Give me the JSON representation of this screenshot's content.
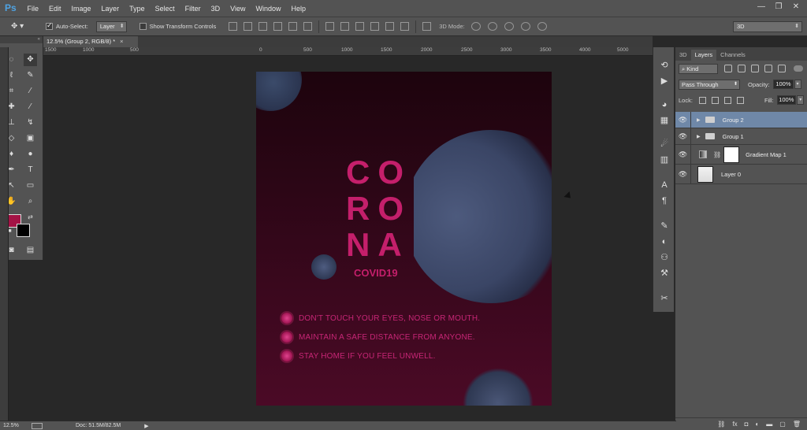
{
  "menubar": {
    "logo": "Ps",
    "items": [
      "File",
      "Edit",
      "Image",
      "Layer",
      "Type",
      "Select",
      "Filter",
      "3D",
      "View",
      "Window",
      "Help"
    ],
    "window_controls": [
      "—",
      "❐",
      "✕"
    ]
  },
  "options": {
    "auto_select_label": "Auto-Select:",
    "auto_select_checked": true,
    "auto_select_value": "Layer",
    "show_transform_label": "Show Transform Controls",
    "show_transform_checked": false,
    "mode_3d_label": "3D Mode:",
    "workspace": "3D"
  },
  "document": {
    "tab_title": "12.5% (Group 2, RGB/8) *",
    "tab_close": "×",
    "ruler_labels": [
      "1500",
      "1000",
      "500",
      "0",
      "500",
      "1000",
      "1500",
      "2000",
      "2500",
      "3000",
      "3500",
      "4000",
      "4500",
      "5000",
      "500",
      "2000",
      "1500",
      "1000"
    ]
  },
  "poster": {
    "line1": "CO",
    "line2": "RO",
    "line3": "NA",
    "subtitle": "COVID19",
    "tips": [
      "DON'T TOUCH YOUR EYES, NOSE OR MOUTH.",
      "MAINTAIN A SAFE DISTANCE FROM ANYONE.",
      "STAY HOME IF YOU FEEL UNWELL."
    ],
    "accent_color": "#c41f6b"
  },
  "colors": {
    "foreground": "#a31345",
    "background": "#000000"
  },
  "statusbar": {
    "zoom": "12.5%",
    "doc_info": "Doc: 51.5M/82.5M"
  },
  "layers_panel": {
    "tabs": [
      "3D",
      "Layers",
      "Channels"
    ],
    "active_tab": "Layers",
    "filter_kind": "Kind",
    "blend_mode": "Pass Through",
    "opacity_label": "Opacity:",
    "opacity": "100%",
    "lock_label": "Lock:",
    "fill_label": "Fill:",
    "fill": "100%",
    "layers": [
      {
        "name": "Group 2",
        "type": "group",
        "selected": true
      },
      {
        "name": "Group 1",
        "type": "group",
        "selected": false
      },
      {
        "name": "Gradient Map 1",
        "type": "adjustment",
        "selected": false
      },
      {
        "name": "Layer 0",
        "type": "pixel",
        "selected": false
      }
    ]
  }
}
